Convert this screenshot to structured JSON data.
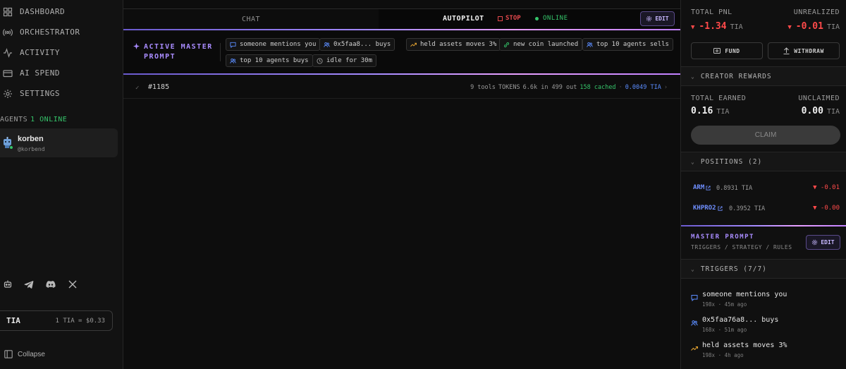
{
  "sidebar": {
    "nav": [
      {
        "label": "DASHBOARD",
        "icon": "grid-icon"
      },
      {
        "label": "ORCHESTRATOR",
        "icon": "broadcast-icon"
      },
      {
        "label": "ACTIVITY",
        "icon": "activity-icon"
      },
      {
        "label": "AI SPEND",
        "icon": "card-icon"
      },
      {
        "label": "SETTINGS",
        "icon": "gear-icon"
      }
    ],
    "agents_label": "AGENTS",
    "agents_online": "1 ONLINE",
    "agent": {
      "name": "korben",
      "handle": "@korbend",
      "status_color": "#35c46a"
    },
    "socials": [
      "robot-icon",
      "telegram-icon",
      "discord-icon",
      "x-icon"
    ],
    "token": {
      "symbol": "TIA",
      "rate": "1 TIA = $0.33"
    },
    "collapse_label": "Collapse"
  },
  "main": {
    "tabs": {
      "chat": "CHAT",
      "autopilot": "AUTOPILOT"
    },
    "stop_label": "STOP",
    "online_label": "ONLINE",
    "edit_label": "EDIT",
    "active_prompt": {
      "line1": "ACTIVE MASTER",
      "line2": "PROMPT"
    },
    "triggers": [
      {
        "label": "someone mentions you",
        "icon": "chat-icon"
      },
      {
        "label": "0x5faa8... buys",
        "icon": "users-icon"
      },
      {
        "label": "held assets moves 3%",
        "icon": "trend-icon"
      },
      {
        "label": "new coin launched",
        "icon": "link-icon"
      },
      {
        "label": "top 10 agents sells",
        "icon": "users-icon"
      },
      {
        "label": "top 10 agents buys",
        "icon": "users-icon"
      },
      {
        "label": "idle for 30m",
        "icon": "clock-icon"
      }
    ],
    "run": {
      "id": "#1185",
      "tools": "9 tools",
      "tokens_label": "TOKENS",
      "tokens": "6.6k in 499 out",
      "cached": "158 cached",
      "sep": "·",
      "cost": "0.0049 TIA",
      "chevron": "›"
    }
  },
  "right": {
    "total_pnl_label": "TOTAL PNL",
    "total_pnl": "-1.34",
    "unrealized_label": "UNREALIZED",
    "unrealized": "-0.01",
    "unit": "TIA",
    "down_arrow": "▼",
    "fund_label": "FUND",
    "withdraw_label": "WITHDRAW",
    "creator_rewards_label": "CREATOR REWARDS",
    "total_earned_label": "TOTAL EARNED",
    "total_earned": "0.16",
    "unclaimed_label": "UNCLAIMED",
    "unclaimed": "0.00",
    "claim_label": "CLAIM",
    "positions_label": "POSITIONS (2)",
    "positions": [
      {
        "ticker": "ARM",
        "amount": "0.8931 TIA",
        "pnl": "-0.01"
      },
      {
        "ticker": "KHPRO2",
        "amount": "0.3952 TIA",
        "pnl": "-0.00"
      }
    ],
    "master_prompt_label": "MASTER PROMPT",
    "master_prompt_sub": "TRIGGERS / STRATEGY / RULES",
    "edit_label": "EDIT",
    "triggers_label": "TRIGGERS (7/7)",
    "trigger_list": [
      {
        "name": "someone mentions you",
        "meta": "198x · 45m ago",
        "icon": "chat-icon",
        "color": "#5b8dff"
      },
      {
        "name": "0x5faa76a8... buys",
        "meta": "168x · 51m ago",
        "icon": "users-icon",
        "color": "#5b8dff"
      },
      {
        "name": "held assets moves 3%",
        "meta": "198x · 4h ago",
        "icon": "trend-icon",
        "color": "#e0a030"
      }
    ],
    "colors": {
      "negative": "#ff4a4a",
      "accent": "#a98cff",
      "online": "#35c46a",
      "link": "#6f8fff"
    }
  }
}
